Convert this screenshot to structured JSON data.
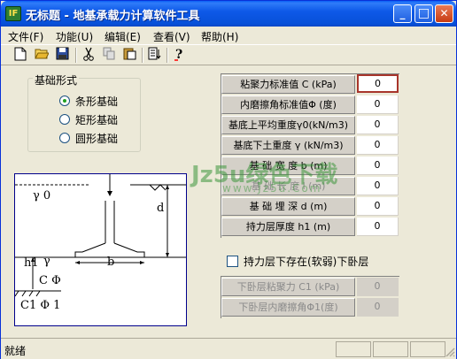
{
  "window": {
    "app_icon_text": "IF",
    "title": "无标题 - 地基承载力计算软件工具",
    "controls": {
      "minimize": "_",
      "maximize": "□",
      "close": "✕"
    }
  },
  "menu": [
    "文件(F)",
    "功能(U)",
    "编辑(E)",
    "查看(V)",
    "帮助(H)"
  ],
  "toolbar_icons": [
    "new-file-icon",
    "open-folder-icon",
    "save-icon",
    "cut-icon",
    "copy-icon",
    "paste-icon",
    "export-icon",
    "help-icon"
  ],
  "foundation_group": {
    "label": "基础形式",
    "options": [
      "条形基础",
      "矩形基础",
      "圆形基础"
    ],
    "selected": "条形基础"
  },
  "diagram": {
    "labels": {
      "gamma0": "γ 0",
      "h1": "h1",
      "gamma": "γ",
      "d": "d",
      "b": "b",
      "c_phi": "C  Φ",
      "c1_phi1": "C1   Φ 1"
    }
  },
  "params": [
    {
      "label": "粘聚力标准值 C  (kPa)",
      "value": "0",
      "focused": true
    },
    {
      "label": "内磨擦角标准值Φ  (度)",
      "value": "0"
    },
    {
      "label": "基底上平均重度γ0(kN/m3)",
      "value": "0"
    },
    {
      "label": "基底下土重度 γ  (kN/m3)",
      "value": "0"
    },
    {
      "label": "基 础 宽 度 b    (m)",
      "value": "0"
    },
    {
      "label": "基 础 长 度 l    (m)",
      "value": "0"
    },
    {
      "label": "基 础 埋 深 d    (m)",
      "value": "0"
    },
    {
      "label": "持力层厚度 h1    (m)",
      "value": "0"
    }
  ],
  "weak_layer": {
    "checkbox_label": "持力层下存在(软弱)下卧层",
    "checked": false,
    "params": [
      {
        "label": "下卧层粘聚力 C1 (kPa)",
        "value": "0"
      },
      {
        "label": "下卧层内磨擦角Φ1(度)",
        "value": "0"
      }
    ]
  },
  "watermark": {
    "main": "Jz5u绿色下载",
    "sub": "www.Jz5u.Com"
  },
  "status": {
    "text": "就绪"
  }
}
